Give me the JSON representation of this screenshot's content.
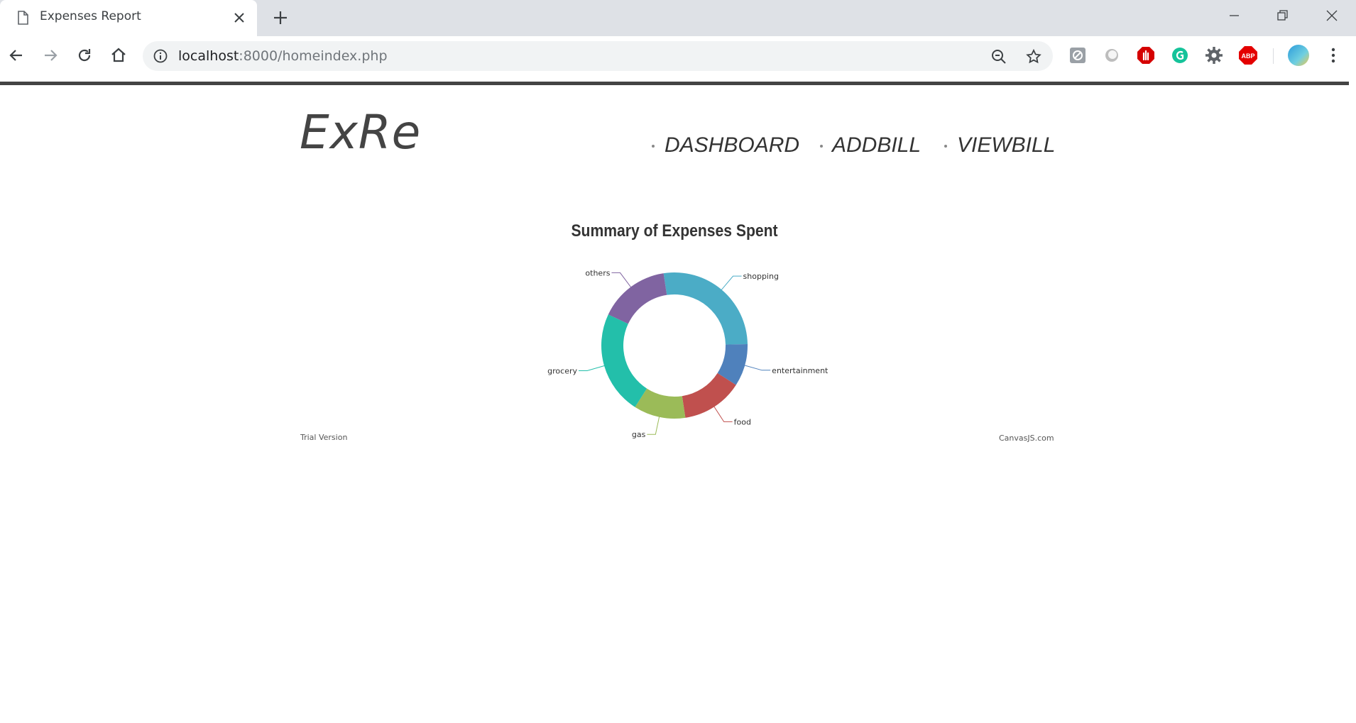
{
  "browser": {
    "tab_title": "Expenses Report",
    "url_host": "localhost",
    "url_rest": ":8000/homeindex.php"
  },
  "site": {
    "logo": "ExRe",
    "nav": [
      {
        "label": "DASHBOARD"
      },
      {
        "label": "ADDBILL"
      },
      {
        "label": "VIEWBILL"
      }
    ],
    "trial_text": "Trial Version",
    "credit_text": "CanvasJS.com"
  },
  "chart_data": {
    "type": "pie",
    "variant": "doughnut",
    "title": "Summary of Expenses Spent",
    "slices": [
      {
        "label": "shopping",
        "value": 26,
        "color": "#4BACC6"
      },
      {
        "label": "entertainment",
        "value": 9,
        "color": "#4F81BC"
      },
      {
        "label": "food",
        "value": 13,
        "color": "#C0504E"
      },
      {
        "label": "gas",
        "value": 11,
        "color": "#9BBB58"
      },
      {
        "label": "grocery",
        "value": 22,
        "color": "#23BFAA"
      },
      {
        "label": "others",
        "value": 15,
        "color": "#8064A1"
      }
    ],
    "legend": "none"
  }
}
